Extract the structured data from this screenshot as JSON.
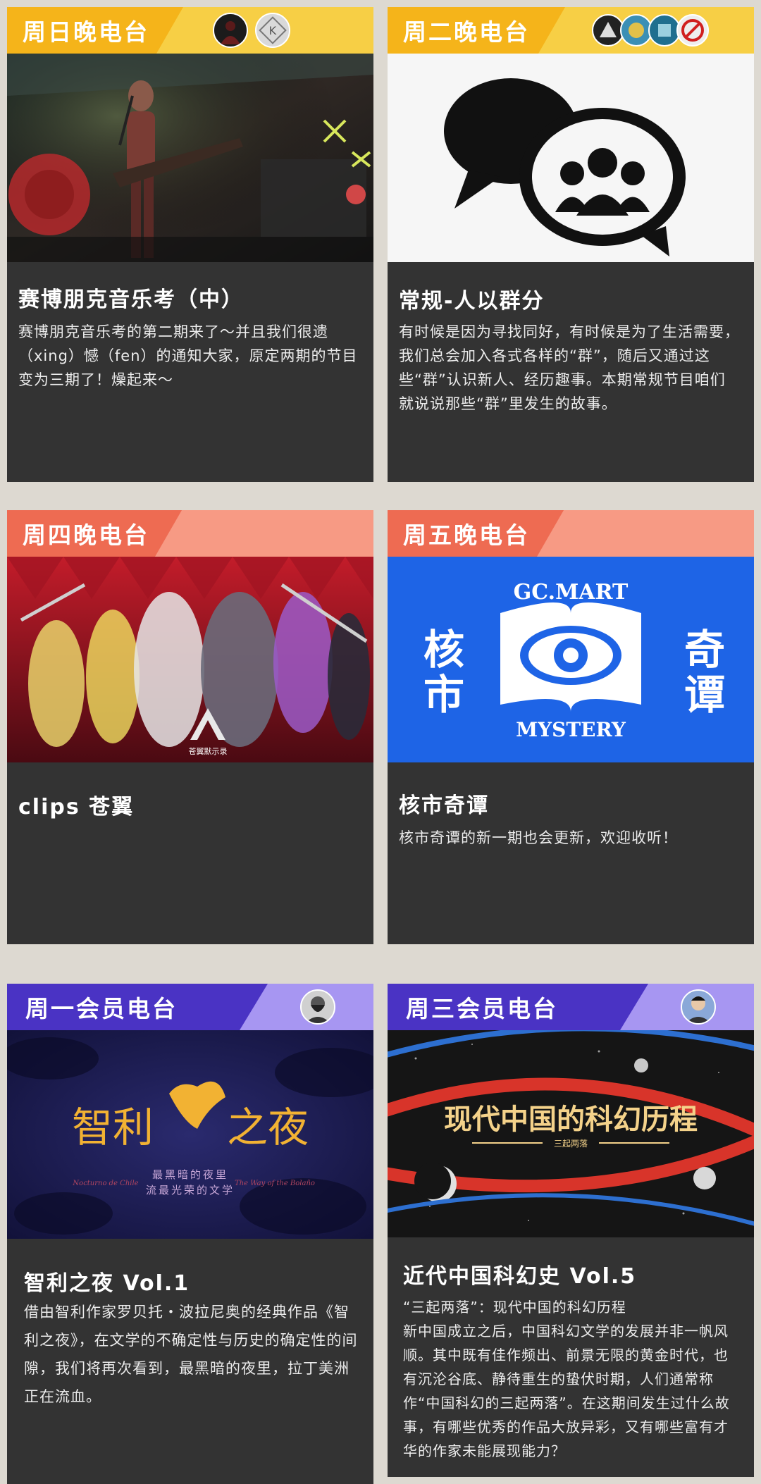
{
  "colors": {
    "page_bg": "#ddd9d1",
    "card_bg": "#333333",
    "yellow_header": "#f5b41a",
    "yellow_slant": "#f7cf45",
    "red_header": "#ee6b52",
    "red_slant": "#f79a84",
    "purple_header": "#4a33c4",
    "purple_slant": "#a796f2"
  },
  "cards": [
    {
      "header": "周日晚电台",
      "avatars": [
        "dark-figure-avatar",
        "k-letter-avatar"
      ],
      "avatar_k": "K",
      "image_name": "cyberpunk-guitarist-image",
      "title": "赛博朋克音乐考（中）",
      "desc": "赛博朋克音乐考的第二期来了～并且我们很遗（xing）憾（fen）的通知大家，原定两期的节目变为三期了！燥起来～"
    },
    {
      "header": "周二晚电台",
      "avatars": [
        "avatar-1",
        "avatar-2",
        "avatar-3",
        "avatar-4"
      ],
      "image_name": "group-chat-bubble-icon",
      "title": "常规-人以群分",
      "desc": "有时候是因为寻找同好，有时候是为了生活需要，我们总会加入各式各样的“群”，随后又通过这些“群”认识新人、经历趣事。本期常规节目咱们就说说那些“群”里发生的故事。"
    },
    {
      "header": "周四晚电台",
      "avatars": [],
      "image_name": "anime-fighters-image",
      "image_logo": "苍翼默示录",
      "title": "clips 苍翼",
      "desc": ""
    },
    {
      "header": "周五晚电台",
      "avatars": [],
      "image_name": "gc-mart-mystery-logo",
      "logo_top": "GC.MART",
      "logo_bottom": "MYSTERY",
      "logo_left": "核市",
      "logo_right": "奇谭",
      "title": "核市奇谭",
      "desc": "核市奇谭的新一期也会更新，欢迎收听！"
    },
    {
      "header": "周一会员电台",
      "avatars": [
        "bearded-man-avatar"
      ],
      "image_name": "chile-night-poster",
      "poster_title_a": "智利",
      "poster_title_b": "之夜",
      "poster_sub1": "最黑暗的夜里",
      "poster_sub2": "流最光荣的文学",
      "poster_left": "Nocturno de Chile",
      "poster_right": "The Way of the Bolaño",
      "title": "智利之夜 Vol.1",
      "desc": "借由智利作家罗贝托・波拉尼奥的经典作品《智利之夜》，在文学的不确定性与历史的确定性的间隙，我们将再次看到，最黑暗的夜里，拉丁美洲正在流血。"
    },
    {
      "header": "周三会员电台",
      "avatars": [
        "smiling-man-avatar"
      ],
      "image_name": "chinese-scifi-poster",
      "poster_title": "现代中国的科幻历程",
      "poster_sub": "三起两落",
      "title": "近代中国科幻史 Vol.5",
      "desc_lead": "“三起两落”：现代中国的科幻历程",
      "desc": "新中国成立之后，中国科幻文学的发展并非一帆风顺。其中既有佳作频出、前景无限的黄金时代，也有沉沦谷底、静待重生的蛰伏时期，人们通常称作“中国科幻的三起两落”。在这期间发生过什么故事，有哪些优秀的作品大放异彩，又有哪些富有才华的作家未能展现能力？"
    }
  ]
}
